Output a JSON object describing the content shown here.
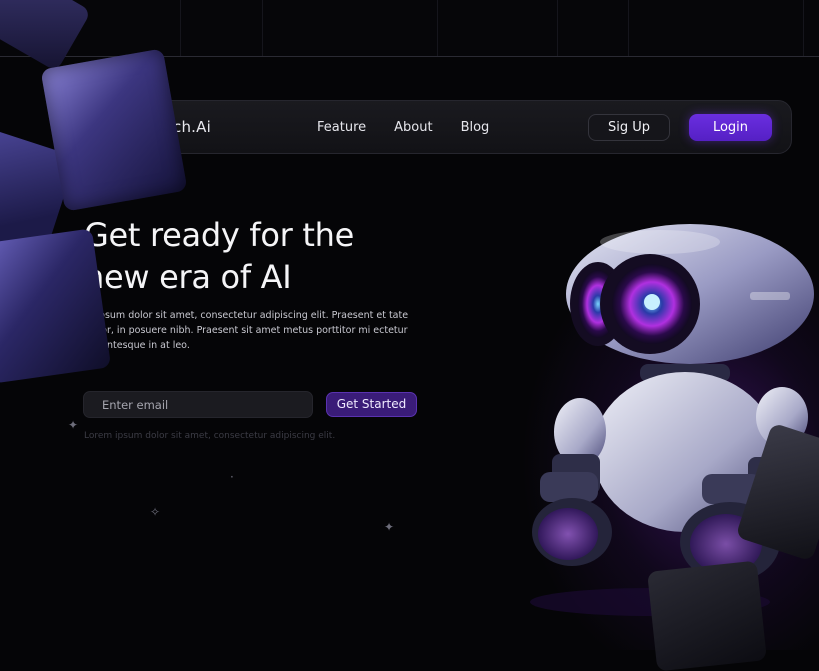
{
  "brand": {
    "name": "ch.Ai"
  },
  "nav": {
    "links": [
      "Feature",
      "About",
      "Blog"
    ]
  },
  "buttons": {
    "signup": "Sig Up",
    "login": "Login",
    "get_started": "Get Started"
  },
  "hero": {
    "title_line1": "Get ready for the",
    "title_line2": "new era of AI",
    "description": "m ipsum dolor sit amet, consectetur adipiscing elit. Praesent et tate tortor, in posuere nibh. Praesent sit amet metus porttitor mi ectetur pellentesque in at leo."
  },
  "email": {
    "placeholder": "Enter email"
  },
  "fine_print": "Lorem ipsum dolor sit amet, consectetur adipiscing elit.",
  "icons": {
    "sparkle": "sparkle-icon"
  },
  "colors": {
    "accent": "#6a2ee0",
    "background": "#050507",
    "glow": "#5a1e96"
  }
}
